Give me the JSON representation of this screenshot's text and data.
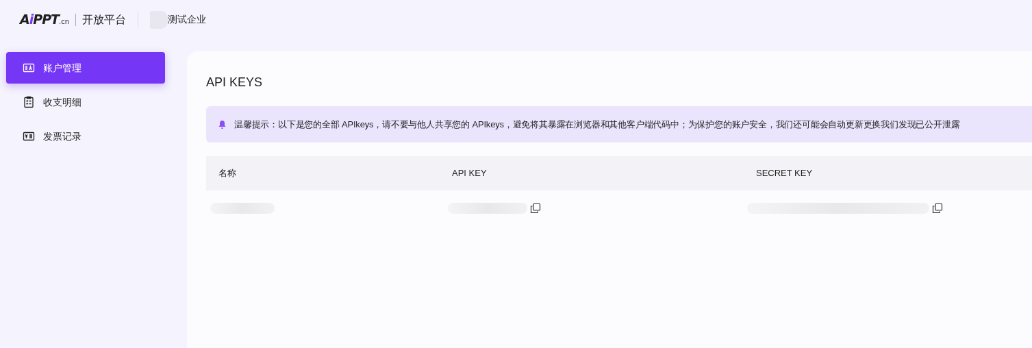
{
  "header": {
    "logo": {
      "mark": "Ai",
      "text": "PPT",
      "suffix": ".cn"
    },
    "platform": "开放平台",
    "company": "测试企业"
  },
  "sidebar": {
    "items": [
      {
        "label": "账户管理",
        "selected": true
      },
      {
        "label": "收支明细",
        "selected": false
      },
      {
        "label": "发票记录",
        "selected": false
      }
    ]
  },
  "page": {
    "title": "API KEYS",
    "notice": "温馨提示：以下是您的全部 APIkeys，请不要与他人共享您的 APIkeys，避免将其暴露在浏览器和其他客户端代码中；为保护您的账户安全，我们还可能会自动更新更换我们发现已公开泄露",
    "table": {
      "columns": [
        "名称",
        "API KEY",
        "SECRET KEY"
      ],
      "rows": [
        {
          "name": {
            "kind": "redacted"
          },
          "api_key": {
            "kind": "copyable"
          },
          "secret_key": {
            "kind": "copyable"
          }
        }
      ]
    }
  }
}
